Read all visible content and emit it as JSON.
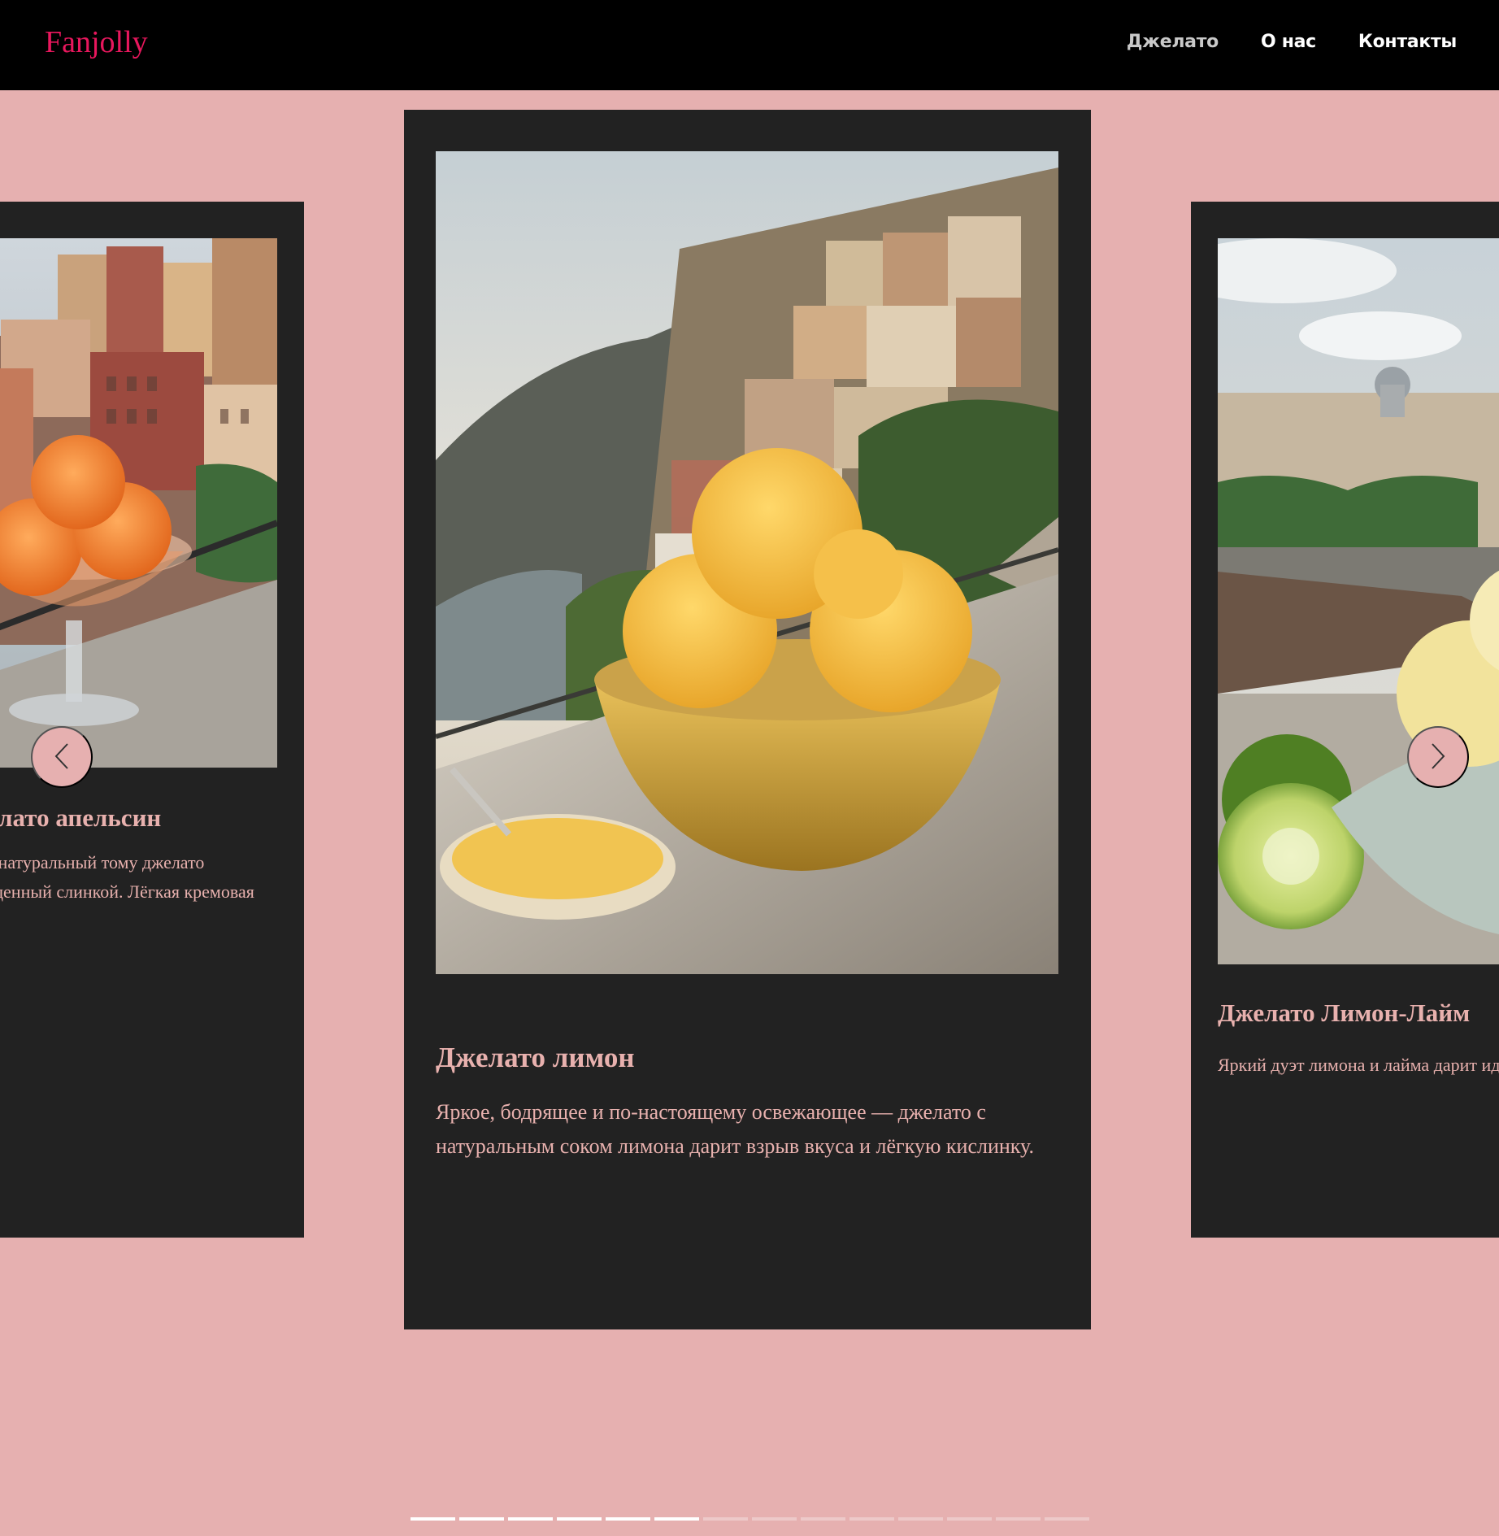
{
  "brand": {
    "name": "Fanjolly",
    "color": "#e8175d"
  },
  "nav": {
    "items": [
      {
        "label": "Джелато",
        "active": true
      },
      {
        "label": "О нас",
        "active": false
      },
      {
        "label": "Контакты",
        "active": false
      }
    ]
  },
  "carousel": {
    "prev_icon": "chevron-left-icon",
    "next_icon": "chevron-right-icon",
    "slides": {
      "left": {
        "image": "orange-gelato-in-glass-coupe-photo",
        "title": "Джелато апельсин",
        "description": "ий — натуральный тому джелато насыщенный слинкой. Лёгкая кремовая"
      },
      "center": {
        "image": "lemon-gelato-bowl-coastal-village-photo",
        "title": "Джелато лимон",
        "description": "Яркое, бодрящее и по-настоящему освежающее — джелато с натуральным соком лимона дарит взрыв вкуса и лёгкую кислинку."
      },
      "right": {
        "image": "lemon-lime-gelato-with-lime-halves-photo",
        "title": "Джелато Лимон-Лайм",
        "description": "Яркий дуэт лимона и лайма дарит идеальным балансом кислинки"
      }
    },
    "pagination": {
      "total": 14,
      "active_count": 6
    }
  },
  "colors": {
    "background": "#e6b0b0",
    "card": "#222222",
    "card_text": "#e8b1ae",
    "nav_bg": "#000000"
  }
}
